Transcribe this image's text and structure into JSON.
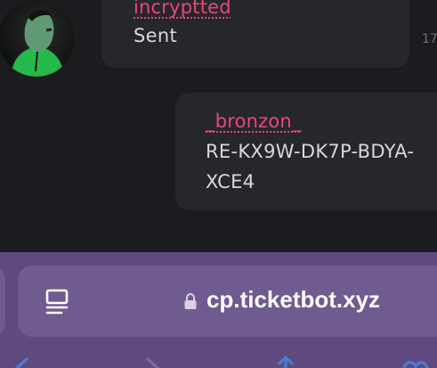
{
  "messages": [
    {
      "sender": "incryptted",
      "lines": [
        "Sent"
      ],
      "time": "17"
    },
    {
      "sender": "_bronzon_",
      "lines": [
        "RE-KX9W-DK7P-BDYA-",
        "XCE4"
      ]
    }
  ],
  "browser": {
    "url": "cp.ticketbot.xyz"
  },
  "icons": {
    "avatar": "green-character-avatar",
    "reader": "reader-view-icon",
    "lock": "lock-icon",
    "back": "back-arrow-icon",
    "forward": "forward-arrow-icon",
    "share": "share-icon",
    "bookmarks": "bookmarks-icon"
  },
  "colors": {
    "background": "#1b1c1f",
    "bubble": "#26272b",
    "sender_name": "#e8477a",
    "message_text": "#d8d8da",
    "browser_bar": "#5e4a7e",
    "url_field": "#6f5b8f"
  }
}
